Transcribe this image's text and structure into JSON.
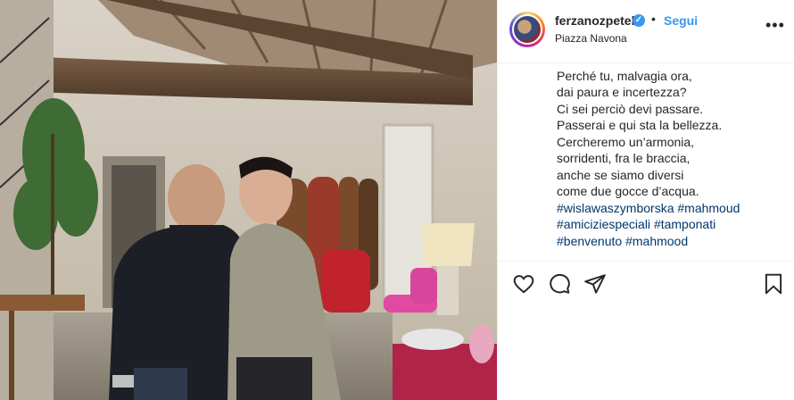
{
  "header": {
    "username": "ferzanozpetek",
    "verified_icon": "verified-badge-icon",
    "separator": "•",
    "follow_label": "Segui",
    "location": "Piazza Navona",
    "more_icon": "more-options-icon"
  },
  "caption": {
    "lines": [
      "Perché tu, malvagia ora,",
      "dai paura e incertezza?",
      "Ci sei perciò devi passare.",
      "Passerai e qui sta la bellezza.",
      "Cercheremo un’armonia,",
      "sorridenti, fra le braccia,",
      "anche se siamo diversi",
      "come due gocce d’acqua."
    ],
    "hashtags": [
      [
        "#wislawaszymborska",
        "#mahmoud"
      ],
      [
        "#amiciziespeciali",
        "#tamponati"
      ],
      [
        "#benvenuto",
        "#mahmood"
      ]
    ]
  },
  "actions": {
    "like_icon": "heart-icon",
    "comment_icon": "comment-icon",
    "share_icon": "share-icon",
    "save_icon": "bookmark-icon"
  },
  "colors": {
    "link": "#00376b",
    "follow": "#3897f0",
    "text": "#262626",
    "border": "#efefef"
  }
}
